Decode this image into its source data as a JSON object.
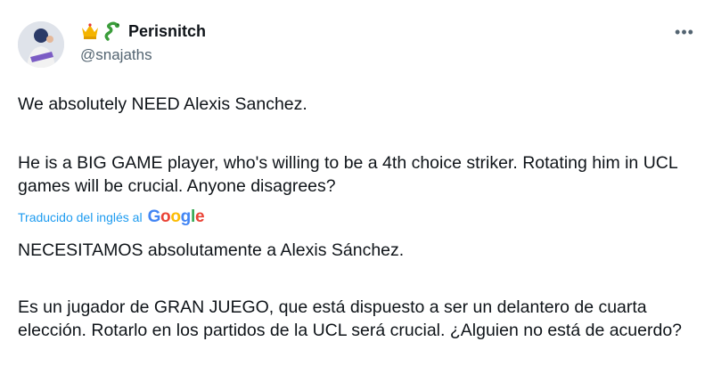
{
  "user": {
    "display_name": "Perisnitch",
    "handle": "@snajaths",
    "badges": [
      "crown-emoji",
      "snake-emoji"
    ]
  },
  "tweet": {
    "text_line1": "We absolutely NEED Alexis Sanchez.",
    "text_paragraph2": "He is a BIG GAME player, who's willing to be a 4th choice striker. Rotating him in UCL games will be crucial. Anyone disagrees?",
    "translated_label": "Traducido del inglés al",
    "translation_provider": "Google",
    "translated_line1": "NECESITAMOS absolutamente a Alexis Sánchez.",
    "translated_paragraph2": "Es un jugador de GRAN JUEGO, que está dispuesto a ser un delantero de cuarta elección. Rotarlo en los partidos de la UCL será crucial. ¿Alguien no está de acuerdo?"
  },
  "icons": {
    "more": "more-options-icon"
  },
  "colors": {
    "text": "#0f1419",
    "secondary": "#536471",
    "link": "#1d9bf0",
    "google_blue": "#4285f4",
    "google_red": "#ea4335",
    "google_yellow": "#fbbc05",
    "google_green": "#34a853"
  }
}
